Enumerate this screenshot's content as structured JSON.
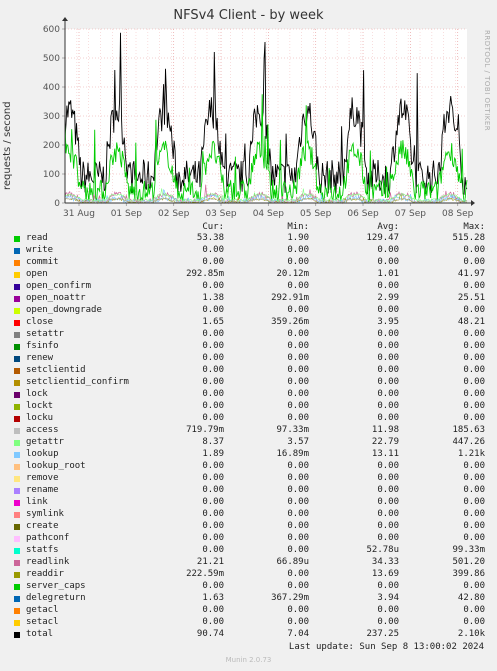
{
  "title": "NFSv4 Client - by week",
  "side_text": "RRDTOOL / TOBI OETIKER",
  "footer": {
    "last_update": "Last update: Sun Sep  8 13:00:02 2024",
    "version": "Munin 2.0.73"
  },
  "legend_headers": {
    "cur": "Cur:",
    "min": "Min:",
    "avg": "Avg:",
    "max": "Max:"
  },
  "chart_data": {
    "type": "line",
    "title": "NFSv4 Client - by week",
    "ylabel": "requests / second",
    "ylim": [
      0,
      600
    ],
    "yticks": [
      "0",
      "100",
      "200",
      "300",
      "400",
      "500",
      "600"
    ],
    "xticks": [
      "31 Aug",
      "01 Sep",
      "02 Sep",
      "03 Sep",
      "04 Sep",
      "05 Sep",
      "06 Sep",
      "07 Sep",
      "08 Sep"
    ],
    "grid": true,
    "series": [
      {
        "name": "read",
        "color": "#00cc00",
        "cur": "53.38",
        "min": "1.90",
        "avg": "129.47",
        "max": "515.28"
      },
      {
        "name": "write",
        "color": "#0066b3",
        "cur": "0.00",
        "min": "0.00",
        "avg": "0.00",
        "max": "0.00"
      },
      {
        "name": "commit",
        "color": "#ff8000",
        "cur": "0.00",
        "min": "0.00",
        "avg": "0.00",
        "max": "0.00"
      },
      {
        "name": "open",
        "color": "#ffcc00",
        "cur": "292.85m",
        "min": "20.12m",
        "avg": "1.01",
        "max": "41.97"
      },
      {
        "name": "open_confirm",
        "color": "#330099",
        "cur": "0.00",
        "min": "0.00",
        "avg": "0.00",
        "max": "0.00"
      },
      {
        "name": "open_noattr",
        "color": "#990099",
        "cur": "1.38",
        "min": "292.91m",
        "avg": "2.99",
        "max": "25.51"
      },
      {
        "name": "open_downgrade",
        "color": "#ccff00",
        "cur": "0.00",
        "min": "0.00",
        "avg": "0.00",
        "max": "0.00"
      },
      {
        "name": "close",
        "color": "#ff0000",
        "cur": "1.65",
        "min": "359.26m",
        "avg": "3.95",
        "max": "48.21"
      },
      {
        "name": "setattr",
        "color": "#808080",
        "cur": "0.00",
        "min": "0.00",
        "avg": "0.00",
        "max": "0.00"
      },
      {
        "name": "fsinfo",
        "color": "#008f00",
        "cur": "0.00",
        "min": "0.00",
        "avg": "0.00",
        "max": "0.00"
      },
      {
        "name": "renew",
        "color": "#00487d",
        "cur": "0.00",
        "min": "0.00",
        "avg": "0.00",
        "max": "0.00"
      },
      {
        "name": "setclientid",
        "color": "#b35a00",
        "cur": "0.00",
        "min": "0.00",
        "avg": "0.00",
        "max": "0.00"
      },
      {
        "name": "setclientid_confirm",
        "color": "#b38f00",
        "cur": "0.00",
        "min": "0.00",
        "avg": "0.00",
        "max": "0.00"
      },
      {
        "name": "lock",
        "color": "#6b006b",
        "cur": "0.00",
        "min": "0.00",
        "avg": "0.00",
        "max": "0.00"
      },
      {
        "name": "lockt",
        "color": "#8fb300",
        "cur": "0.00",
        "min": "0.00",
        "avg": "0.00",
        "max": "0.00"
      },
      {
        "name": "locku",
        "color": "#b30000",
        "cur": "0.00",
        "min": "0.00",
        "avg": "0.00",
        "max": "0.00"
      },
      {
        "name": "access",
        "color": "#bebebe",
        "cur": "719.79m",
        "min": "97.33m",
        "avg": "11.98",
        "max": "185.63"
      },
      {
        "name": "getattr",
        "color": "#80ff80",
        "cur": "8.37",
        "min": "3.57",
        "avg": "22.79",
        "max": "447.26"
      },
      {
        "name": "lookup",
        "color": "#80c9ff",
        "cur": "1.89",
        "min": "16.89m",
        "avg": "13.11",
        "max": "1.21k"
      },
      {
        "name": "lookup_root",
        "color": "#ffc080",
        "cur": "0.00",
        "min": "0.00",
        "avg": "0.00",
        "max": "0.00"
      },
      {
        "name": "remove",
        "color": "#ffe680",
        "cur": "0.00",
        "min": "0.00",
        "avg": "0.00",
        "max": "0.00"
      },
      {
        "name": "rename",
        "color": "#aa80ff",
        "cur": "0.00",
        "min": "0.00",
        "avg": "0.00",
        "max": "0.00"
      },
      {
        "name": "link",
        "color": "#ee00cc",
        "cur": "0.00",
        "min": "0.00",
        "avg": "0.00",
        "max": "0.00"
      },
      {
        "name": "symlink",
        "color": "#ff8080",
        "cur": "0.00",
        "min": "0.00",
        "avg": "0.00",
        "max": "0.00"
      },
      {
        "name": "create",
        "color": "#666600",
        "cur": "0.00",
        "min": "0.00",
        "avg": "0.00",
        "max": "0.00"
      },
      {
        "name": "pathconf",
        "color": "#ffbfff",
        "cur": "0.00",
        "min": "0.00",
        "avg": "0.00",
        "max": "0.00"
      },
      {
        "name": "statfs",
        "color": "#00ffcc",
        "cur": "0.00",
        "min": "0.00",
        "avg": "52.78u",
        "max": "99.33m"
      },
      {
        "name": "readlink",
        "color": "#cc6699",
        "cur": "21.21",
        "min": "66.89u",
        "avg": "34.33",
        "max": "501.20"
      },
      {
        "name": "readdir",
        "color": "#999900",
        "cur": "222.59m",
        "min": "0.00",
        "avg": "13.69",
        "max": "399.86"
      },
      {
        "name": "server_caps",
        "color": "#00cc00",
        "cur": "0.00",
        "min": "0.00",
        "avg": "0.00",
        "max": "0.00"
      },
      {
        "name": "delegreturn",
        "color": "#0066b3",
        "cur": "1.63",
        "min": "367.29m",
        "avg": "3.94",
        "max": "42.80"
      },
      {
        "name": "getacl",
        "color": "#ff8000",
        "cur": "0.00",
        "min": "0.00",
        "avg": "0.00",
        "max": "0.00"
      },
      {
        "name": "setacl",
        "color": "#ffcc00",
        "cur": "0.00",
        "min": "0.00",
        "avg": "0.00",
        "max": "0.00"
      },
      {
        "name": "total",
        "color": "#000000",
        "cur": "90.74",
        "min": "7.04",
        "avg": "237.25",
        "max": "2.10k"
      }
    ]
  }
}
